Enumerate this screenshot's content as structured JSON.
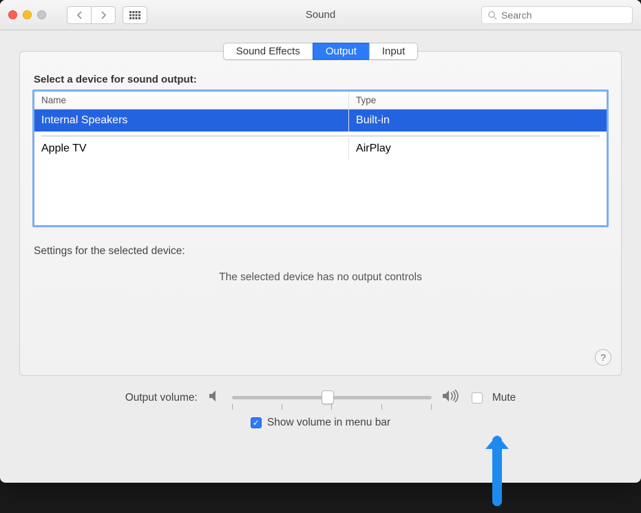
{
  "window": {
    "title": "Sound"
  },
  "search": {
    "placeholder": "Search"
  },
  "tabs": [
    {
      "label": "Sound Effects",
      "active": false
    },
    {
      "label": "Output",
      "active": true
    },
    {
      "label": "Input",
      "active": false
    }
  ],
  "panel": {
    "heading": "Select a device for sound output:",
    "columns": {
      "name": "Name",
      "type": "Type"
    },
    "devices": [
      {
        "name": "Internal Speakers",
        "type": "Built-in",
        "selected": true
      },
      {
        "name": "Apple TV",
        "type": "AirPlay",
        "selected": false
      }
    ],
    "settings_label": "Settings for the selected device:",
    "no_controls": "The selected device has no output controls"
  },
  "volume": {
    "label": "Output volume:",
    "value_percent": 48,
    "mute_label": "Mute",
    "mute_checked": false
  },
  "menubar": {
    "show_label": "Show volume in menu bar",
    "checked": true
  }
}
